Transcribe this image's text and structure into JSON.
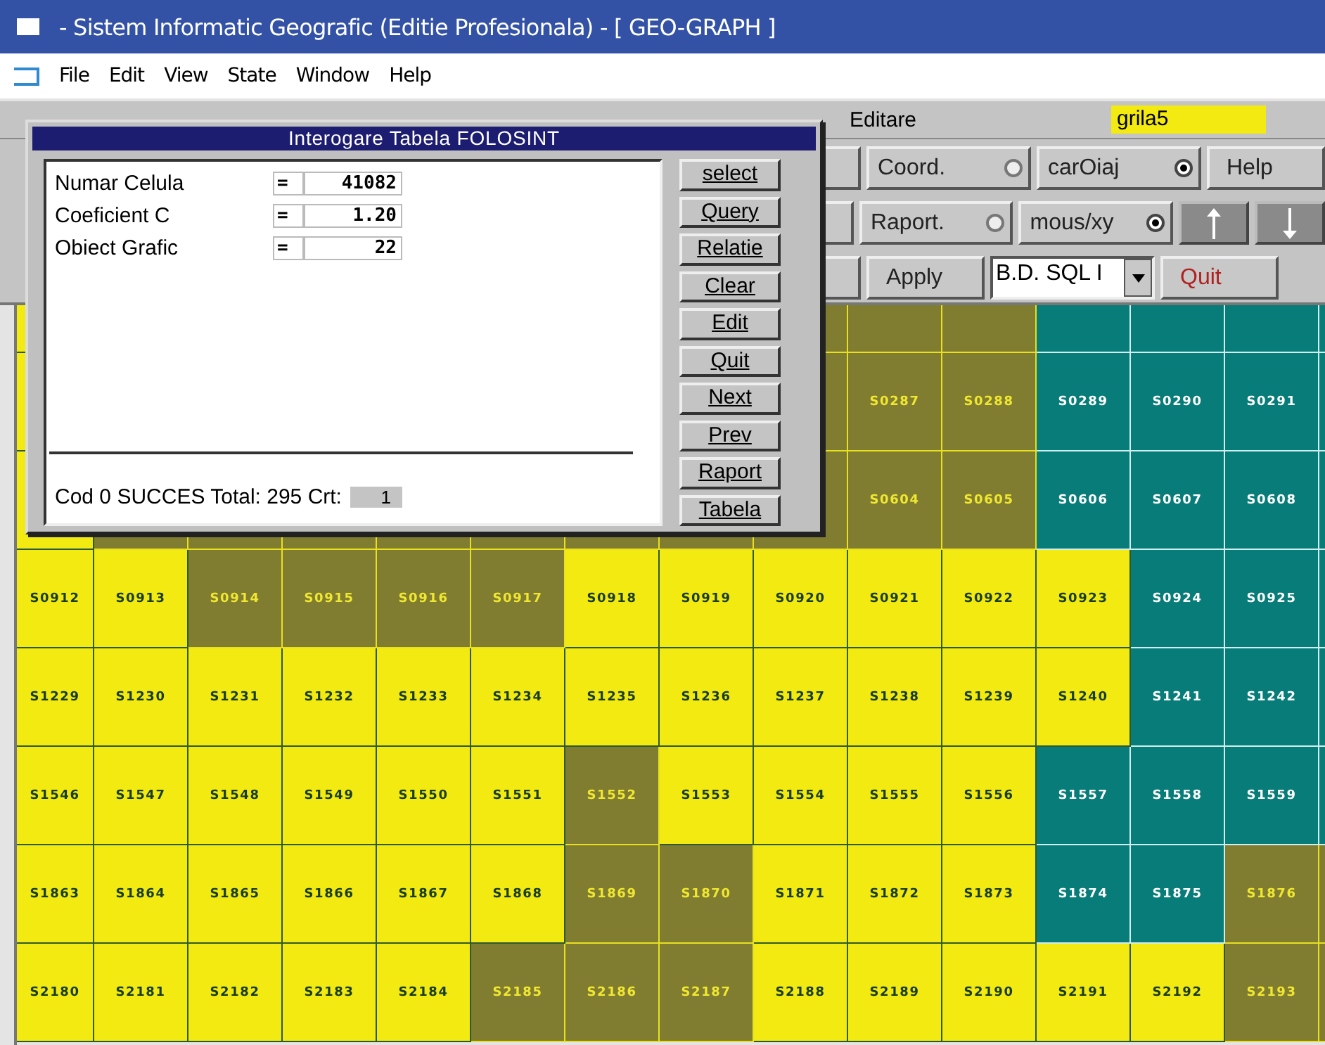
{
  "window": {
    "title": "- Sistem Informatic Geografic (Editie Profesionala) - [ GEO-GRAPH ]"
  },
  "menu": [
    "File",
    "Edit",
    "View",
    "State",
    "Window",
    "Help"
  ],
  "tab_bar": {
    "items": [
      "Editare"
    ],
    "layer": "grila5"
  },
  "toolbar": {
    "rows": [
      [
        {
          "kind": "radio",
          "label": "Coord.",
          "on": false
        },
        {
          "kind": "radio",
          "label": "carOiaj",
          "on": true
        },
        {
          "kind": "button",
          "label": "Help",
          "danger": false
        }
      ],
      [
        {
          "kind": "radio",
          "label": "Raport.",
          "on": false
        },
        {
          "kind": "radio",
          "label": "mous/xy",
          "on": true
        },
        {
          "kind": "up"
        },
        {
          "kind": "down"
        }
      ],
      [
        {
          "kind": "button",
          "label": "Apply",
          "danger": false
        },
        {
          "kind": "dropdown",
          "value": "B.D. SQL I"
        },
        {
          "kind": "button",
          "label": "Quit",
          "danger": true
        }
      ]
    ]
  },
  "dialog": {
    "title": "Interogare Tabela FOLOSINT",
    "fields": [
      {
        "label": "Numar Celula",
        "operator": "=",
        "value": "41082"
      },
      {
        "label": "Coeficient C",
        "operator": "=",
        "value": "1.20"
      },
      {
        "label": "Obiect Grafic",
        "operator": "=",
        "value": "22"
      }
    ],
    "status": "Cod 0 SUCCES Total: 295 Crt:",
    "current": "1",
    "buttons": [
      "select",
      "Query",
      "Relatie",
      "Clear",
      "Edit",
      "Quit",
      "Next",
      "Prev",
      "Raport",
      "Tabela"
    ]
  },
  "grid": {
    "rows": [
      {
        "cells": [
          {
            "color": "#f2ea10"
          },
          null,
          null,
          null,
          null,
          null,
          null,
          null,
          {
            "color": "#807c30"
          },
          {
            "color": "#807c30"
          },
          {
            "color": "#807c30"
          },
          {
            "color": "#087c78"
          },
          {
            "color": "#087c78"
          },
          {
            "color": "#087c78"
          },
          {
            "color": "#087c78"
          }
        ]
      },
      {
        "cells": [
          {
            "color": "#f2ea10"
          },
          null,
          null,
          null,
          null,
          null,
          null,
          null,
          {
            "color": "#807c30"
          },
          {
            "label": "S0287",
            "color": "#807c30"
          },
          {
            "label": "S0288",
            "color": "#807c30"
          },
          {
            "label": "S0289",
            "color": "#087c78"
          },
          {
            "label": "S0290",
            "color": "#087c78"
          },
          {
            "label": "S0291",
            "color": "#087c78"
          },
          {
            "color": "#087c78"
          }
        ]
      },
      {
        "cells": [
          {
            "color": "#f2ea10"
          },
          {
            "color": "#807c30"
          },
          {
            "color": "#807c30"
          },
          {
            "color": "#807c30"
          },
          {
            "color": "#807c30"
          },
          {
            "color": "#807c30"
          },
          {
            "color": "#807c30"
          },
          {
            "color": "#807c30"
          },
          {
            "color": "#807c30"
          },
          {
            "label": "S0604",
            "color": "#807c30"
          },
          {
            "label": "S0605",
            "color": "#807c30"
          },
          {
            "label": "S0606",
            "color": "#087c78"
          },
          {
            "label": "S0607",
            "color": "#087c78"
          },
          {
            "label": "S0608",
            "color": "#087c78"
          },
          {
            "color": "#087c78"
          }
        ]
      },
      {
        "cells": [
          {
            "label": "S0912",
            "color": "#f2ea10"
          },
          {
            "label": "S0913",
            "color": "#f2ea10"
          },
          {
            "label": "S0914",
            "color": "#807c30"
          },
          {
            "label": "S0915",
            "color": "#807c30"
          },
          {
            "label": "S0916",
            "color": "#807c30"
          },
          {
            "label": "S0917",
            "color": "#807c30"
          },
          {
            "label": "S0918",
            "color": "#f2ea10"
          },
          {
            "label": "S0919",
            "color": "#f2ea10"
          },
          {
            "label": "S0920",
            "color": "#f2ea10"
          },
          {
            "label": "S0921",
            "color": "#f2ea10"
          },
          {
            "label": "S0922",
            "color": "#f2ea10"
          },
          {
            "label": "S0923",
            "color": "#f2ea10"
          },
          {
            "label": "S0924",
            "color": "#087c78"
          },
          {
            "label": "S0925",
            "color": "#087c78"
          },
          {
            "color": "#087c78"
          }
        ]
      },
      {
        "cells": [
          {
            "label": "S1229",
            "color": "#f2ea10"
          },
          {
            "label": "S1230",
            "color": "#f2ea10"
          },
          {
            "label": "S1231",
            "color": "#f2ea10"
          },
          {
            "label": "S1232",
            "color": "#f2ea10"
          },
          {
            "label": "S1233",
            "color": "#f2ea10"
          },
          {
            "label": "S1234",
            "color": "#f2ea10"
          },
          {
            "label": "S1235",
            "color": "#f2ea10"
          },
          {
            "label": "S1236",
            "color": "#f2ea10"
          },
          {
            "label": "S1237",
            "color": "#f2ea10"
          },
          {
            "label": "S1238",
            "color": "#f2ea10"
          },
          {
            "label": "S1239",
            "color": "#f2ea10"
          },
          {
            "label": "S1240",
            "color": "#f2ea10"
          },
          {
            "label": "S1241",
            "color": "#087c78"
          },
          {
            "label": "S1242",
            "color": "#087c78"
          },
          {
            "color": "#087c78"
          }
        ]
      },
      {
        "cells": [
          {
            "label": "S1546",
            "color": "#f2ea10"
          },
          {
            "label": "S1547",
            "color": "#f2ea10"
          },
          {
            "label": "S1548",
            "color": "#f2ea10"
          },
          {
            "label": "S1549",
            "color": "#f2ea10"
          },
          {
            "label": "S1550",
            "color": "#f2ea10"
          },
          {
            "label": "S1551",
            "color": "#f2ea10"
          },
          {
            "label": "S1552",
            "color": "#807c30"
          },
          {
            "label": "S1553",
            "color": "#f2ea10"
          },
          {
            "label": "S1554",
            "color": "#f2ea10"
          },
          {
            "label": "S1555",
            "color": "#f2ea10"
          },
          {
            "label": "S1556",
            "color": "#f2ea10"
          },
          {
            "label": "S1557",
            "color": "#087c78"
          },
          {
            "label": "S1558",
            "color": "#087c78"
          },
          {
            "label": "S1559",
            "color": "#087c78"
          },
          {
            "color": "#087c78"
          }
        ]
      },
      {
        "cells": [
          {
            "label": "S1863",
            "color": "#f2ea10"
          },
          {
            "label": "S1864",
            "color": "#f2ea10"
          },
          {
            "label": "S1865",
            "color": "#f2ea10"
          },
          {
            "label": "S1866",
            "color": "#f2ea10"
          },
          {
            "label": "S1867",
            "color": "#f2ea10"
          },
          {
            "label": "S1868",
            "color": "#f2ea10"
          },
          {
            "label": "S1869",
            "color": "#807c30"
          },
          {
            "label": "S1870",
            "color": "#807c30"
          },
          {
            "label": "S1871",
            "color": "#f2ea10"
          },
          {
            "label": "S1872",
            "color": "#f2ea10"
          },
          {
            "label": "S1873",
            "color": "#f2ea10"
          },
          {
            "label": "S1874",
            "color": "#087c78"
          },
          {
            "label": "S1875",
            "color": "#087c78"
          },
          {
            "label": "S1876",
            "color": "#807c30"
          },
          {
            "color": "#807c30"
          }
        ]
      },
      {
        "cells": [
          {
            "label": "S2180",
            "color": "#f2ea10"
          },
          {
            "label": "S2181",
            "color": "#f2ea10"
          },
          {
            "label": "S2182",
            "color": "#f2ea10"
          },
          {
            "label": "S2183",
            "color": "#f2ea10"
          },
          {
            "label": "S2184",
            "color": "#f2ea10"
          },
          {
            "label": "S2185",
            "color": "#807c30"
          },
          {
            "label": "S2186",
            "color": "#807c30"
          },
          {
            "label": "S2187",
            "color": "#807c30"
          },
          {
            "label": "S2188",
            "color": "#f2ea10"
          },
          {
            "label": "S2189",
            "color": "#f2ea10"
          },
          {
            "label": "S2190",
            "color": "#f2ea10"
          },
          {
            "label": "S2191",
            "color": "#f2ea10"
          },
          {
            "label": "S2192",
            "color": "#f2ea10"
          },
          {
            "label": "S2193",
            "color": "#807c30"
          },
          {
            "color": "#807c30"
          }
        ]
      }
    ]
  }
}
